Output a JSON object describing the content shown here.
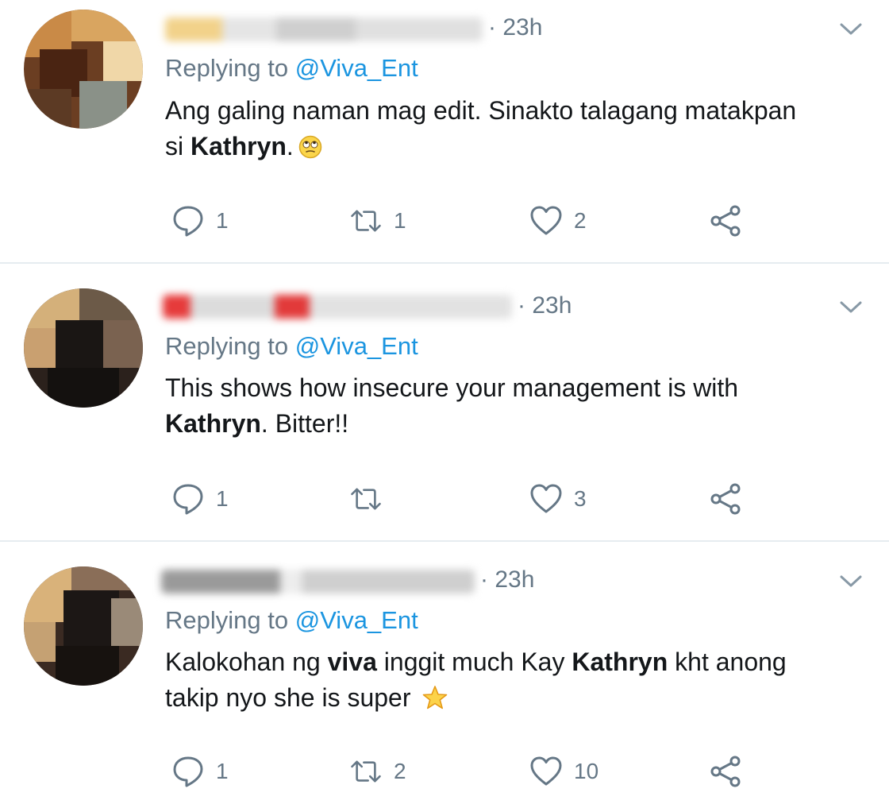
{
  "tweets": [
    {
      "time": "· 23h",
      "replying_prefix": "Replying to",
      "replying_handle": "@Viva_Ent",
      "line1": [
        {
          "text": "Ang galing naman mag edit. Sinakto talagang matakpan",
          "bold": false
        }
      ],
      "line2": [
        {
          "text": "si ",
          "bold": false
        },
        {
          "text": "Kathryn",
          "bold": true
        },
        {
          "text": ".",
          "bold": false
        }
      ],
      "emoji": "face-with-rolling-eyes",
      "counts": {
        "reply": "1",
        "retweet": "1",
        "like": "2"
      }
    },
    {
      "time": "· 23h",
      "replying_prefix": "Replying to",
      "replying_handle": "@Viva_Ent",
      "line1": [
        {
          "text": "This shows how insecure your management is with",
          "bold": false
        }
      ],
      "line2": [
        {
          "text": "Kathryn",
          "bold": true
        },
        {
          "text": ". Bitter!!",
          "bold": false
        }
      ],
      "emoji": "",
      "counts": {
        "reply": "1",
        "retweet": "",
        "like": "3"
      }
    },
    {
      "time": "· 23h",
      "replying_prefix": "Replying to",
      "replying_handle": "@Viva_Ent",
      "line1": [
        {
          "text": "Kalokohan ng ",
          "bold": false
        },
        {
          "text": "viva",
          "bold": true
        },
        {
          "text": " inggit much Kay ",
          "bold": false
        },
        {
          "text": "Kathryn",
          "bold": true
        },
        {
          "text": " kht anong",
          "bold": false
        }
      ],
      "line2": [
        {
          "text": "takip nyo she is super ",
          "bold": false
        }
      ],
      "emoji": "star",
      "counts": {
        "reply": "1",
        "retweet": "2",
        "like": "10"
      }
    }
  ],
  "colors": {
    "text": "#14171a",
    "secondary": "#657786",
    "link": "#1b95e0",
    "divider": "#e6ecf0"
  },
  "icons": [
    "reply-icon",
    "retweet-icon",
    "like-icon",
    "share-icon",
    "chevron-down-icon"
  ]
}
